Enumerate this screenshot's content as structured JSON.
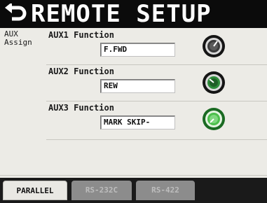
{
  "header": {
    "title": "REMOTE SETUP",
    "back_icon": "return-arrow-icon"
  },
  "aux_assign": {
    "line1": "AUX",
    "line2": "Assign"
  },
  "sections": [
    {
      "label": "AUX1 Function",
      "value": "F.FWD",
      "knob_color": "#2a2a2a",
      "knob_icon": "knob-icon"
    },
    {
      "label": "AUX2 Function",
      "value": "REW",
      "knob_color": "#2e8b3a",
      "knob_icon": "knob-icon"
    },
    {
      "label": "AUX3 Function",
      "value": "MARK SKIP-",
      "knob_color": "#4cbf4c",
      "knob_icon": "knob-icon"
    }
  ],
  "tabs": [
    {
      "label": "PARALLEL",
      "active": true
    },
    {
      "label": "RS-232C",
      "active": false
    },
    {
      "label": "RS-422",
      "active": false
    }
  ],
  "colors": {
    "title_bar": "#0b0b0b",
    "background": "#ecebe6",
    "tab_bar": "#1a1a1a",
    "active_tab": "#e9e8e3",
    "inactive_tab": "#8c8c8c"
  }
}
